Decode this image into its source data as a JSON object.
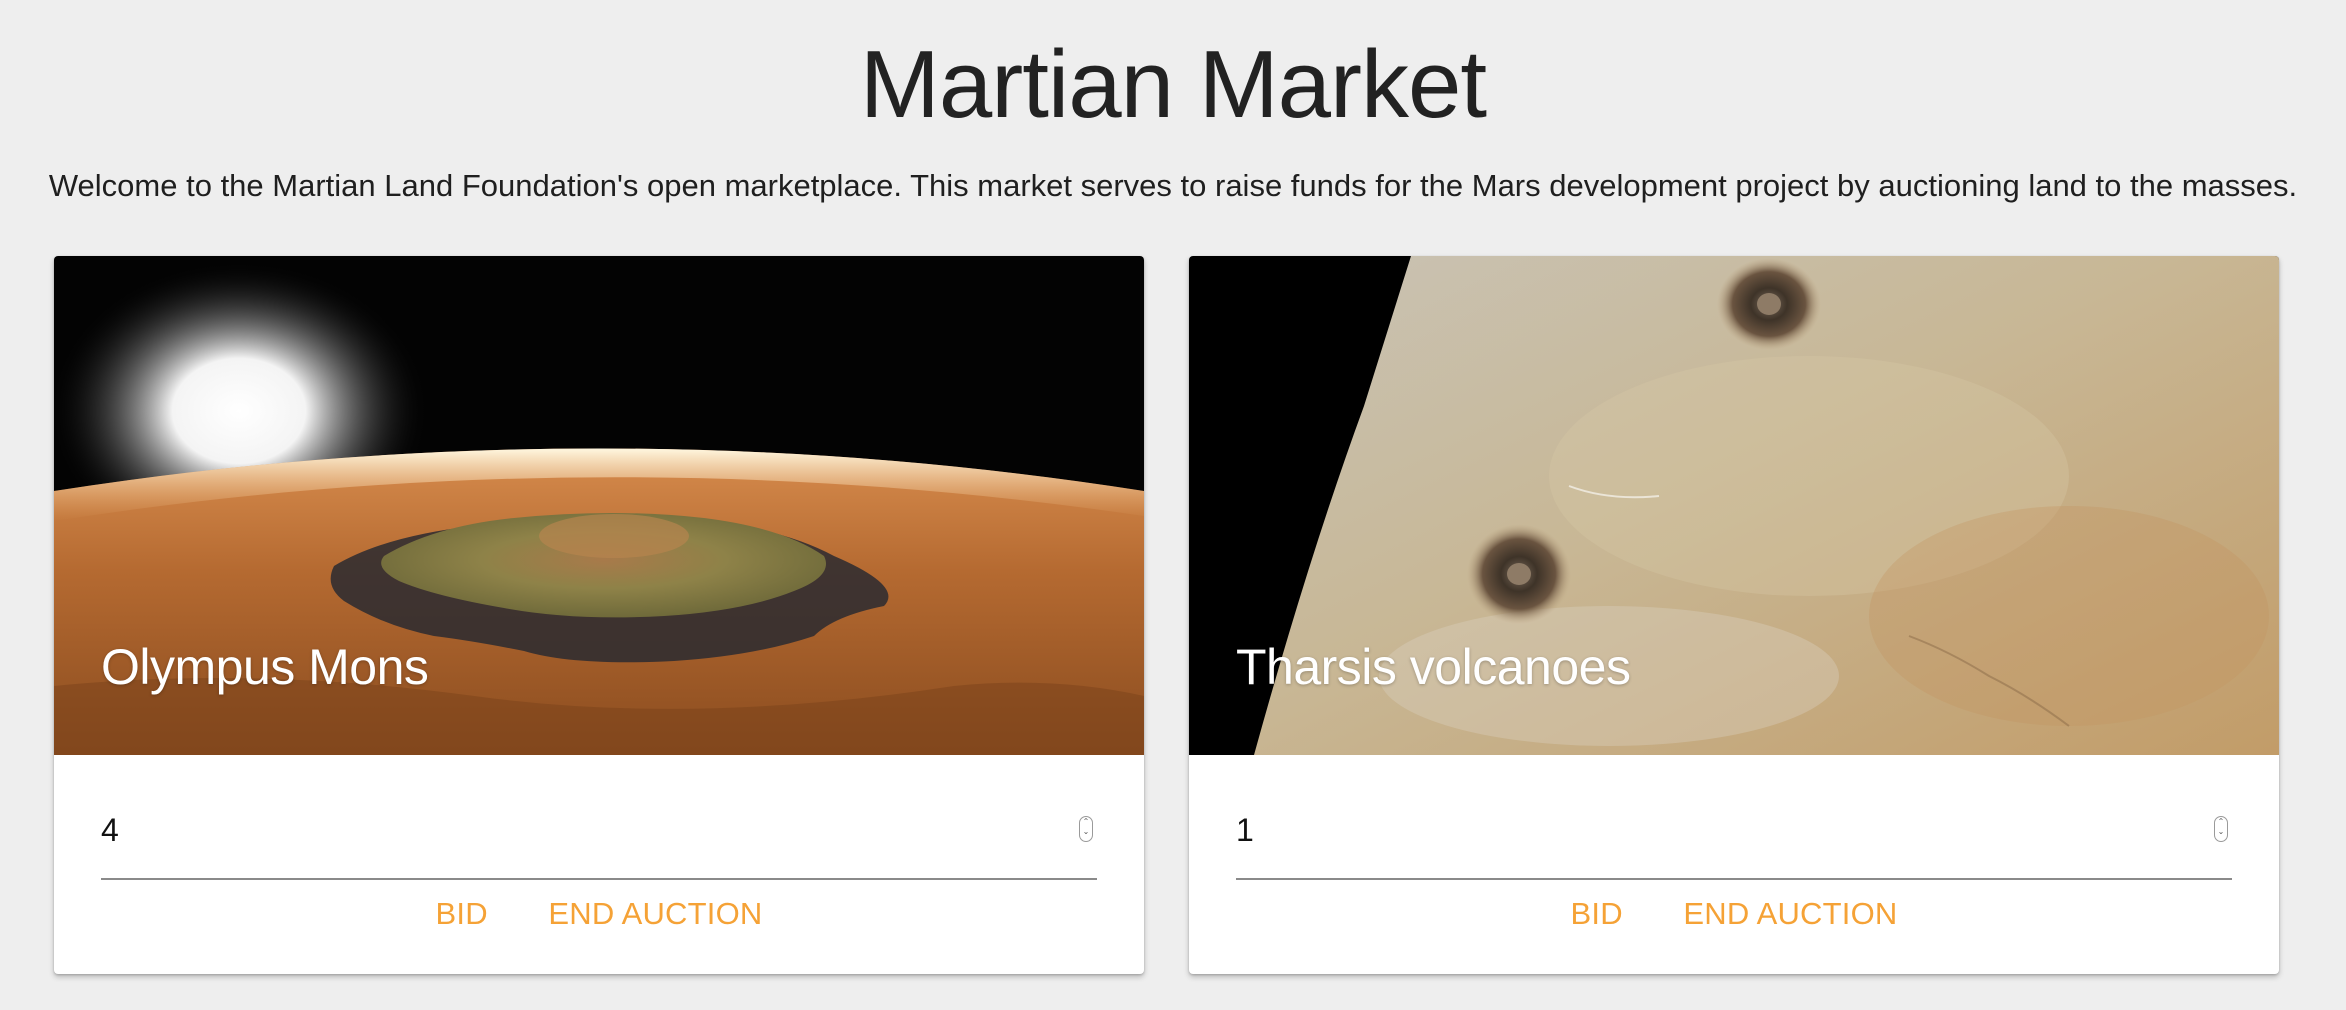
{
  "page": {
    "title": "Martian Market",
    "intro": "Welcome to the Martian Land Foundation's open marketplace. This market serves to raise funds for the Mars development project by auctioning land to the masses."
  },
  "cards": [
    {
      "title": "Olympus Mons",
      "bid_value": "4",
      "bid_label": "BID",
      "end_label": "END AUCTION"
    },
    {
      "title": "Tharsis volcanoes",
      "bid_value": "1",
      "bid_label": "BID",
      "end_label": "END AUCTION"
    }
  ],
  "colors": {
    "background": "#eeeeee",
    "accent": "#f5a236",
    "card": "#ffffff"
  },
  "icons": {
    "stepper": "number-stepper-icon"
  }
}
